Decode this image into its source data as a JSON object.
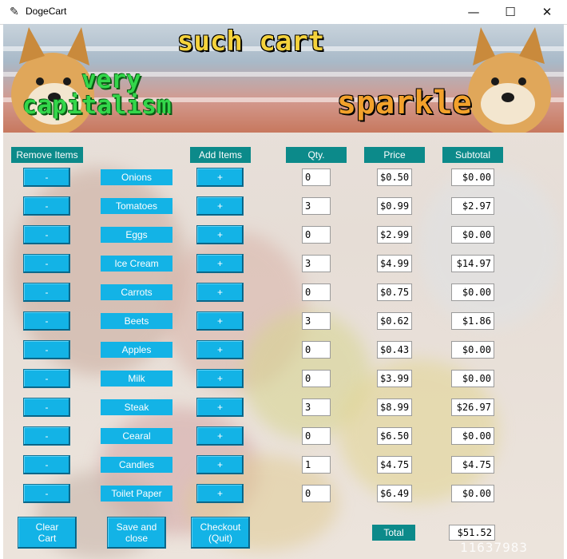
{
  "window": {
    "title": "DogeCart",
    "minimize": "—",
    "maximize": "☐",
    "close": "✕"
  },
  "banner": {
    "top": "such cart",
    "left1": "very",
    "left2": "capitalism",
    "right": "sparkle"
  },
  "headers": {
    "remove": "Remove Items",
    "add": "Add Items",
    "qty": "Qty.",
    "price": "Price",
    "subtotal": "Subtotal"
  },
  "minus_label": "-",
  "plus_label": "+",
  "items": [
    {
      "name": "Onions",
      "qty": "0",
      "price": "$0.50",
      "subtotal": "$0.00"
    },
    {
      "name": "Tomatoes",
      "qty": "3",
      "price": "$0.99",
      "subtotal": "$2.97"
    },
    {
      "name": "Eggs",
      "qty": "0",
      "price": "$2.99",
      "subtotal": "$0.00"
    },
    {
      "name": "Ice Cream",
      "qty": "3",
      "price": "$4.99",
      "subtotal": "$14.97"
    },
    {
      "name": "Carrots",
      "qty": "0",
      "price": "$0.75",
      "subtotal": "$0.00"
    },
    {
      "name": "Beets",
      "qty": "3",
      "price": "$0.62",
      "subtotal": "$1.86"
    },
    {
      "name": "Apples",
      "qty": "0",
      "price": "$0.43",
      "subtotal": "$0.00"
    },
    {
      "name": "Milk",
      "qty": "0",
      "price": "$3.99",
      "subtotal": "$0.00"
    },
    {
      "name": "Steak",
      "qty": "3",
      "price": "$8.99",
      "subtotal": "$26.97"
    },
    {
      "name": "Cearal",
      "qty": "0",
      "price": "$6.50",
      "subtotal": "$0.00"
    },
    {
      "name": "Candles",
      "qty": "1",
      "price": "$4.75",
      "subtotal": "$4.75"
    },
    {
      "name": "Toilet Paper",
      "qty": "0",
      "price": "$6.49",
      "subtotal": "$0.00"
    }
  ],
  "footer": {
    "clear": "Clear\nCart",
    "save": "Save and\nclose",
    "checkout": "Checkout\n(Quit)",
    "total_label": "Total",
    "total_value": "$51.52"
  },
  "watermark": "11637983",
  "colors": {
    "header": "#0c8a8a",
    "button": "#13b3e6"
  }
}
